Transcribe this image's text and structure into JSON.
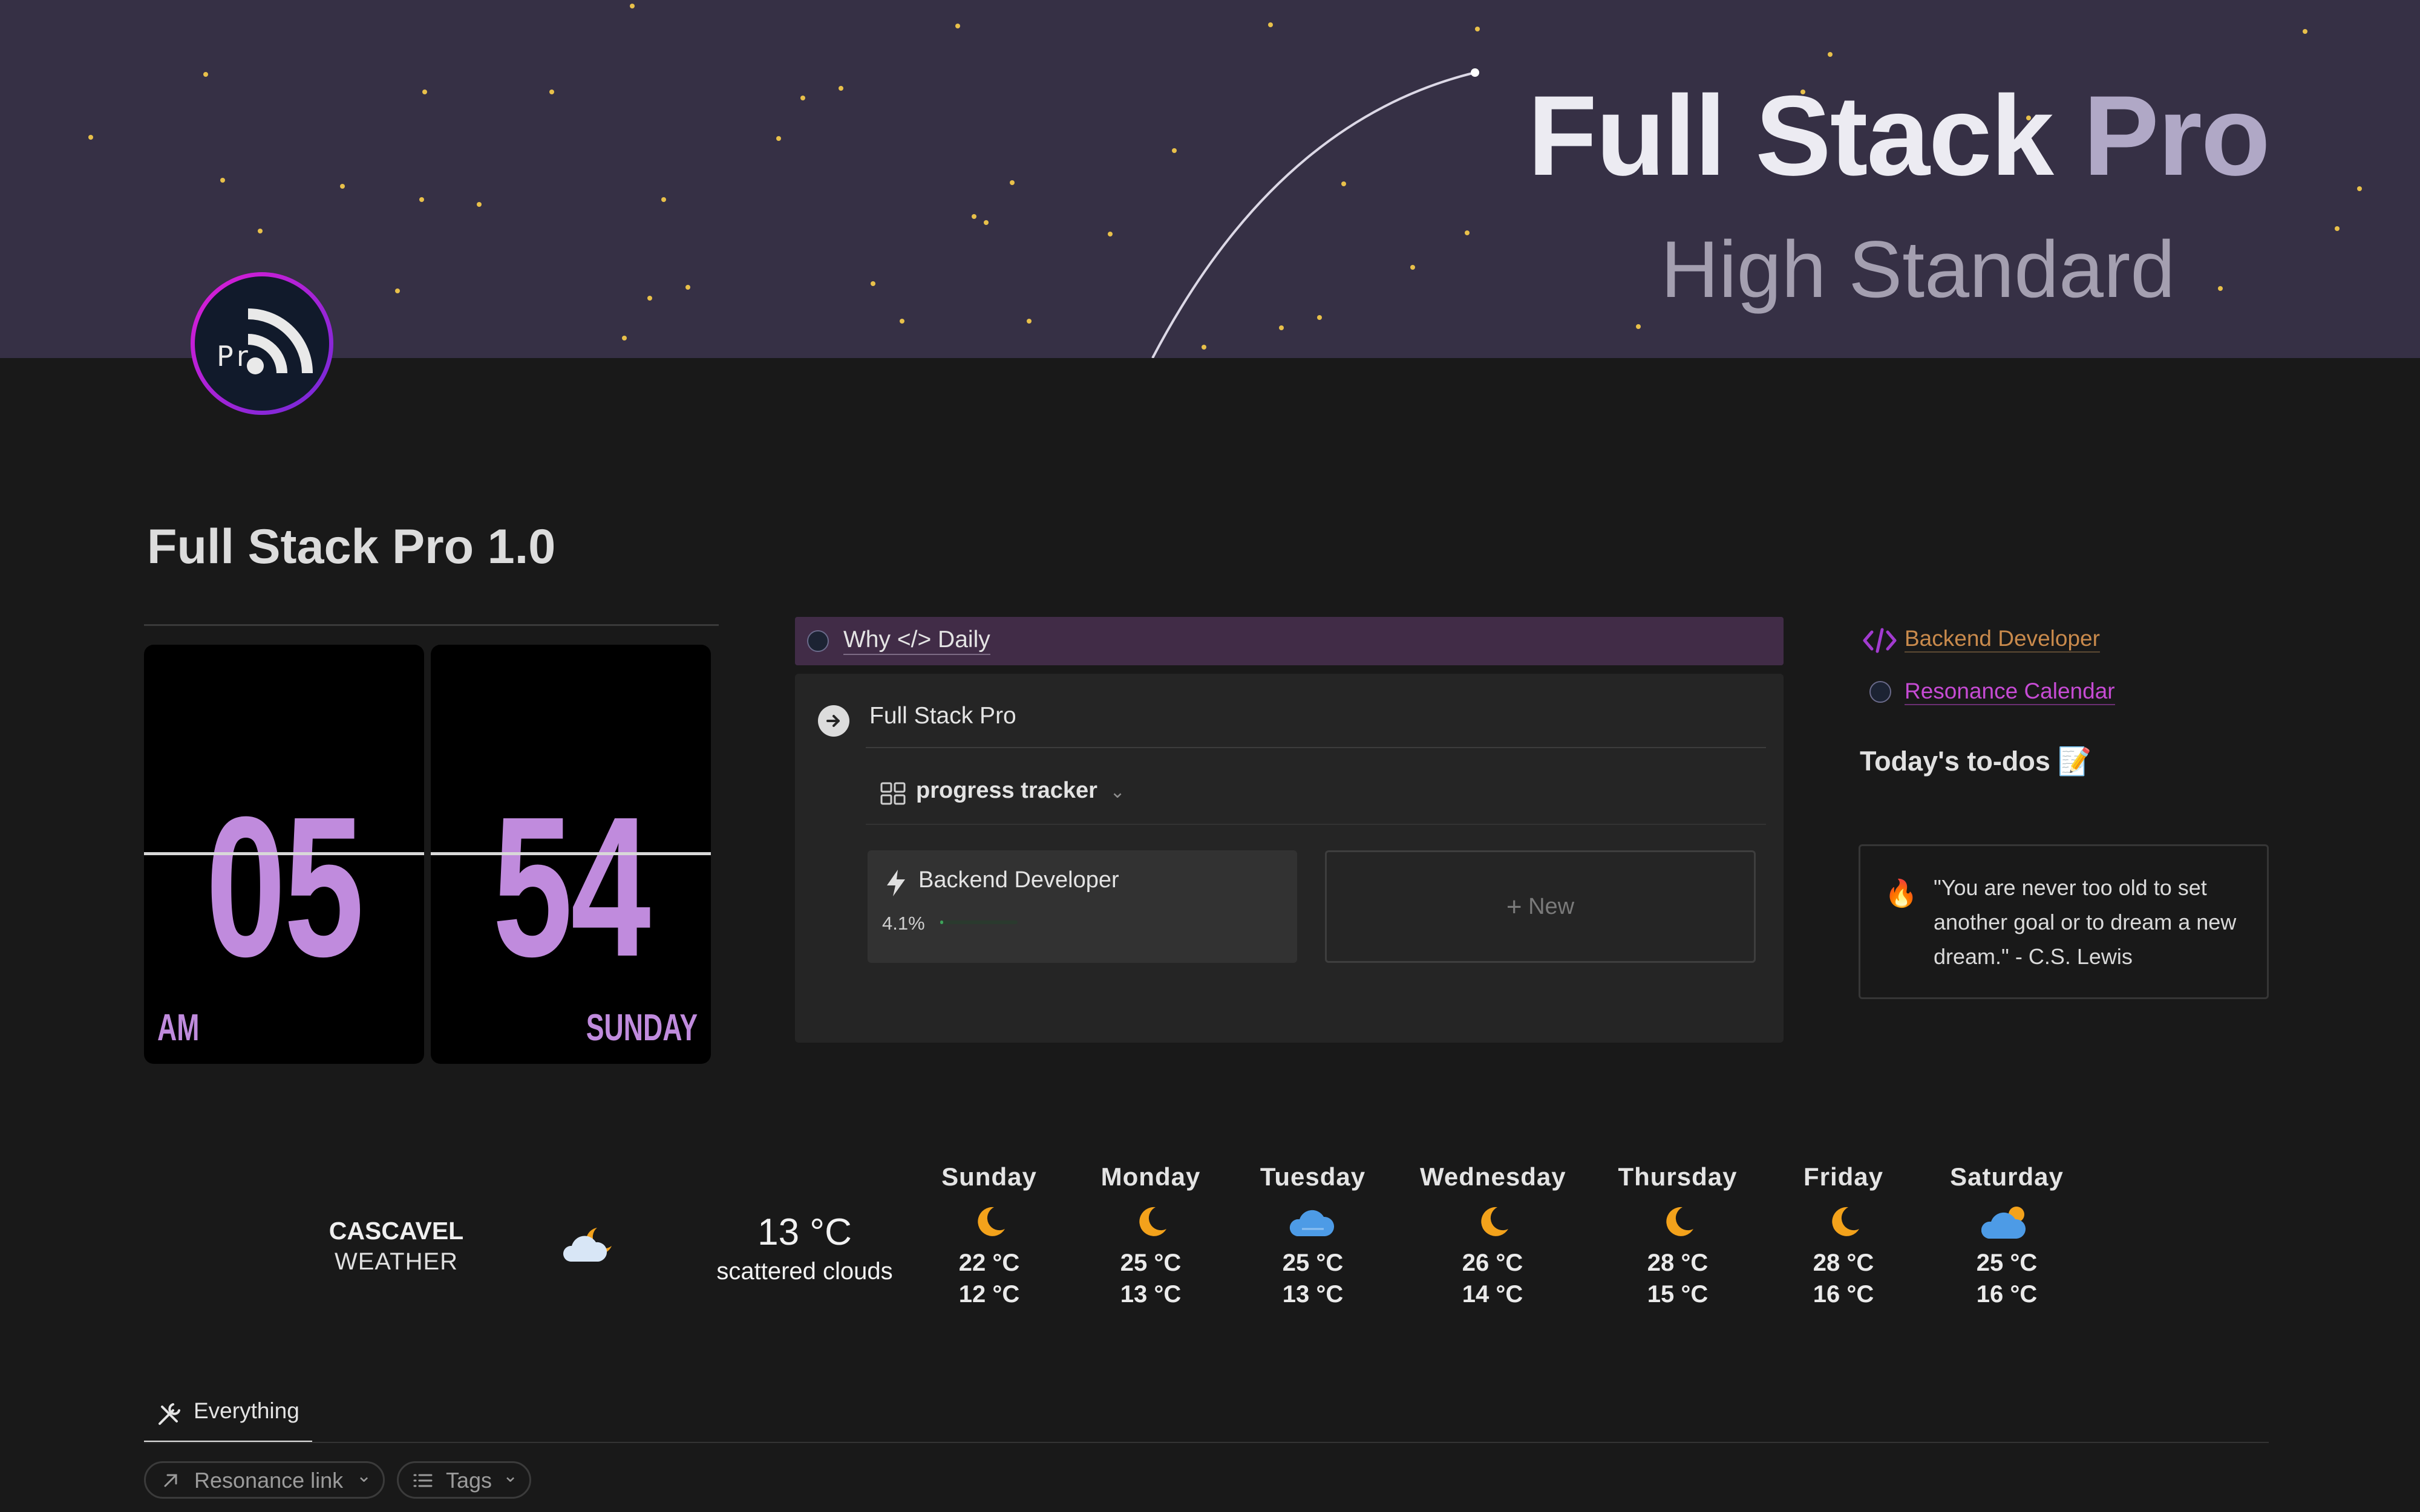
{
  "banner": {
    "title_main": "Full Stack ",
    "title_accent": "Pro",
    "subtitle": "High Standard"
  },
  "avatar": {
    "text": "Pr",
    "icon": "rss-icon"
  },
  "page": {
    "title": "Full Stack Pro 1.0"
  },
  "clock": {
    "hours": "05",
    "minutes": "54",
    "meridiem": "AM",
    "weekday": "SUNDAY",
    "accent": "#c08bdd"
  },
  "why_bar": {
    "label": "Why </> Daily"
  },
  "panel": {
    "source_label": "Full Stack Pro",
    "view_label": "progress tracker",
    "card": {
      "title": "Backend Developer",
      "progress_text": "4.1%",
      "progress": 0.041
    },
    "new_label": "New"
  },
  "links": {
    "backend": "Backend Developer",
    "resonance": "Resonance Calendar"
  },
  "todos": {
    "title": "Today's to-dos 📝",
    "quote_icon": "🔥",
    "quote": "\"You are never too old to set another goal or to dream a new dream.\" - C.S. Lewis"
  },
  "weather": {
    "city": "CASCAVEL",
    "label": "WEATHER",
    "current_temp": "13 °C",
    "current_desc": "scattered clouds",
    "current_icon": "cloud-moon-icon",
    "forecast": [
      {
        "day": "Sunday",
        "hi": "22 °C",
        "lo": "12 °C",
        "icon": "moon-icon"
      },
      {
        "day": "Monday",
        "hi": "25 °C",
        "lo": "13 °C",
        "icon": "moon-icon"
      },
      {
        "day": "Tuesday",
        "hi": "25 °C",
        "lo": "13 °C",
        "icon": "cloud-icon"
      },
      {
        "day": "Wednesday",
        "hi": "26 °C",
        "lo": "14 °C",
        "icon": "moon-icon"
      },
      {
        "day": "Thursday",
        "hi": "28 °C",
        "lo": "15 °C",
        "icon": "moon-icon"
      },
      {
        "day": "Friday",
        "hi": "28 °C",
        "lo": "16 °C",
        "icon": "moon-icon"
      },
      {
        "day": "Saturday",
        "hi": "25 °C",
        "lo": "16 °C",
        "icon": "cloud-sun-icon"
      }
    ]
  },
  "tabs": {
    "everything": "Everything"
  },
  "filters": {
    "resonance_link": "Resonance link",
    "tags": "Tags"
  }
}
